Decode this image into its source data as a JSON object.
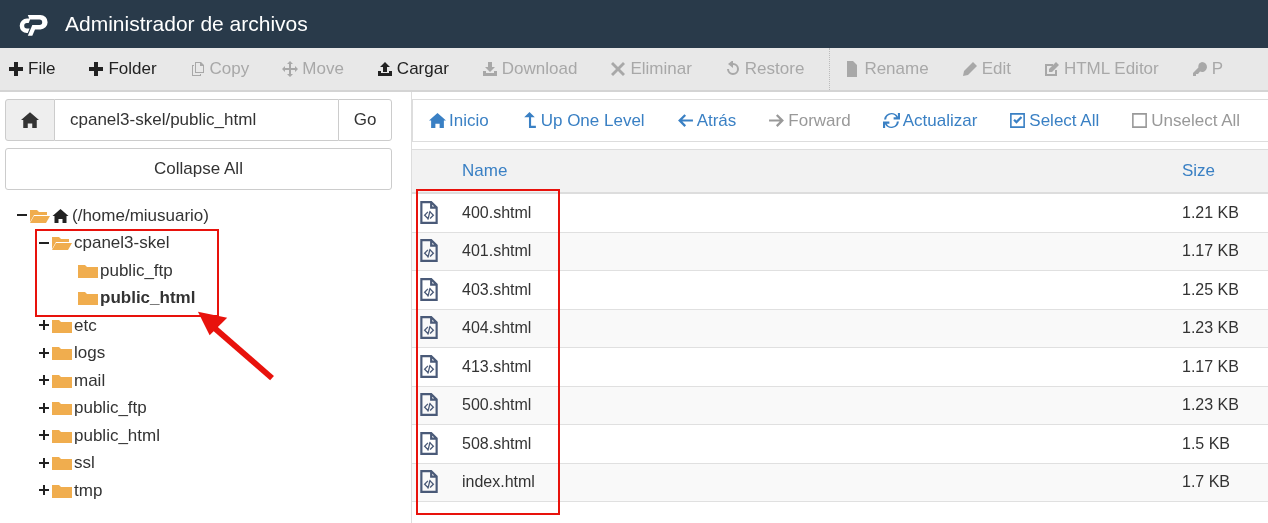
{
  "header": {
    "title": "Administrador de archivos"
  },
  "toolbar": [
    {
      "kind": "new-file",
      "label": "File",
      "disabled": false
    },
    {
      "kind": "new-folder",
      "label": "Folder",
      "disabled": false
    },
    {
      "kind": "copy",
      "label": "Copy",
      "disabled": true
    },
    {
      "kind": "move",
      "label": "Move",
      "disabled": true
    },
    {
      "kind": "upload",
      "label": "Cargar",
      "disabled": false
    },
    {
      "kind": "download",
      "label": "Download",
      "disabled": true
    },
    {
      "kind": "delete",
      "label": "Eliminar",
      "disabled": true
    },
    {
      "kind": "restore",
      "label": "Restore",
      "disabled": true
    },
    {
      "kind": "rename",
      "label": "Rename",
      "disabled": true,
      "group_start": true
    },
    {
      "kind": "edit",
      "label": "Edit",
      "disabled": true
    },
    {
      "kind": "html-editor",
      "label": "HTML Editor",
      "disabled": true
    },
    {
      "kind": "permissions",
      "label": "P",
      "disabled": true
    }
  ],
  "path_bar": {
    "value": "cpanel3-skel/public_html",
    "go": "Go"
  },
  "collapse_all": "Collapse All",
  "tree": [
    {
      "label": "(/home/miusuario)",
      "kind": "home",
      "expanded": true,
      "selected": false,
      "children": [
        {
          "label": "cpanel3-skel",
          "expanded": true,
          "selected": false,
          "annotated": true,
          "children": [
            {
              "label": "public_ftp",
              "selected": false
            },
            {
              "label": "public_html",
              "selected": true
            }
          ]
        },
        {
          "label": "etc",
          "expanded": false,
          "selected": false,
          "annotated": false
        },
        {
          "label": "logs",
          "expanded": false,
          "selected": false,
          "annotated": false
        },
        {
          "label": "mail",
          "expanded": false,
          "selected": false,
          "annotated": false
        },
        {
          "label": "public_ftp",
          "expanded": false,
          "selected": false,
          "annotated": false
        },
        {
          "label": "public_html",
          "expanded": false,
          "selected": false,
          "annotated": false
        },
        {
          "label": "ssl",
          "expanded": false,
          "selected": false,
          "annotated": false
        },
        {
          "label": "tmp",
          "expanded": false,
          "selected": false,
          "annotated": false
        }
      ]
    }
  ],
  "nav": [
    {
      "kind": "home",
      "label": "Inicio",
      "disabled": false
    },
    {
      "kind": "up",
      "label": "Up One Level",
      "disabled": false
    },
    {
      "kind": "back",
      "label": "Atrás",
      "disabled": false
    },
    {
      "kind": "forward",
      "label": "Forward",
      "disabled": true
    },
    {
      "kind": "refresh",
      "label": "Actualizar",
      "disabled": false
    },
    {
      "kind": "select-all",
      "label": "Select All",
      "disabled": false
    },
    {
      "kind": "unselect-all",
      "label": "Unselect All",
      "disabled": true
    }
  ],
  "table": {
    "columns": [
      "Name",
      "Size"
    ],
    "name_column_annotated": true,
    "rows": [
      {
        "name": "400.shtml",
        "size": "1.21 KB"
      },
      {
        "name": "401.shtml",
        "size": "1.17 KB"
      },
      {
        "name": "403.shtml",
        "size": "1.25 KB"
      },
      {
        "name": "404.shtml",
        "size": "1.23 KB"
      },
      {
        "name": "413.shtml",
        "size": "1.17 KB"
      },
      {
        "name": "500.shtml",
        "size": "1.23 KB"
      },
      {
        "name": "508.shtml",
        "size": "1.5 KB"
      },
      {
        "name": "index.html",
        "size": "1.7 KB"
      }
    ]
  }
}
